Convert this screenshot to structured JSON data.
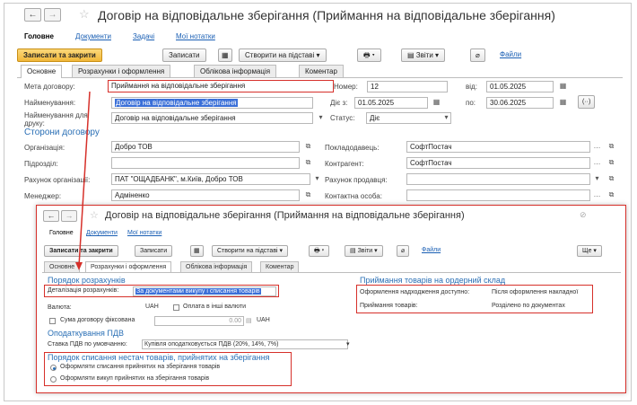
{
  "main_form": {
    "title": "Договір на відповідальне зберігання (Приймання на відповідальне зберігання)",
    "nav_tabs": [
      "Головне",
      "Документи",
      "Задачі",
      "Мої нотатки"
    ],
    "toolbar": {
      "save_close": "Записати та закрити",
      "save": "Записати",
      "create_based": "Створити на підставі",
      "reports": "Звіти",
      "files": "Файли"
    },
    "form_tabs": [
      "Основне",
      "Розрахунки і оформлення",
      "Облікова інформація",
      "Коментар"
    ],
    "fields": {
      "purpose_label": "Мета договору:",
      "purpose_value": "Приймання на відповідальне зберігання",
      "number_label": "Номер:",
      "number_value": "12",
      "from_label": "від:",
      "from_value": "01.05.2025",
      "name_label": "Найменування:",
      "name_value": "Договір на відповідальне зберігання",
      "valid_from_label": "Діє з:",
      "valid_from_value": "01.05.2025",
      "to_label": "по:",
      "to_value": "30.06.2025",
      "print_name_label": "Найменування для друку:",
      "print_name_value": "Договір на відповідальне зберігання",
      "status_label": "Статус:",
      "status_value": "Діє"
    },
    "parties": {
      "heading": "Сторони договору",
      "org_label": "Організація:",
      "org_value": "Добро ТОВ",
      "supplier_label": "Покладодавець:",
      "supplier_value": "СофтПостач",
      "division_label": "Підрозділ:",
      "division_value": "",
      "counterparty_label": "Контрагент:",
      "counterparty_value": "СофтПостач",
      "org_account_label": "Рахунок організації:",
      "org_account_value": "ПАТ \"ОЩАДБАНК\", м.Київ, Добро ТОВ",
      "seller_account_label": "Рахунок продавця:",
      "seller_account_value": "",
      "manager_label": "Менеджер:",
      "manager_value": "Адміненко",
      "contact_label": "Контактна особа:",
      "contact_value": ""
    }
  },
  "sub_form": {
    "title": "Договір на відповідальне зберігання (Приймання на відповідальне зберігання)",
    "nav_tabs": [
      "Головне",
      "Документи",
      "Мої нотатки"
    ],
    "toolbar": {
      "save_close": "Записати та закрити",
      "save": "Записати",
      "create_based": "Створити на підставі",
      "reports": "Звіти",
      "files": "Файли",
      "more": "Ще"
    },
    "form_tabs": [
      "Основне",
      "Розрахунки і оформлення",
      "Облікова інформація",
      "Коментар"
    ],
    "settlement": {
      "heading": "Порядок розрахунків",
      "detail_label": "Деталізація розрахунків:",
      "detail_value": "За документами викупу і списання товарів",
      "currency_label": "Валюта:",
      "currency_value": "UAH",
      "other_currency_label": "Оплата в інші валюти",
      "fixed_sum_label": "Сума договору фіксована",
      "sum_value": "0.00",
      "sum_currency": "UAH"
    },
    "taxation": {
      "heading": "Оподаткування ПДВ",
      "vat_label": "Ставка ПДВ по умовчанню:",
      "vat_value": "Купівля оподатковується ПДВ (20%, 14%, 7%)"
    },
    "writeoff": {
      "heading": "Порядок списання нестач товарів, прийнятих на зберігання",
      "option1": "Оформляти списання прийнятих на зберігання товарів",
      "option2": "Оформляти викуп прийнятих на зберігання товарів"
    },
    "receipt": {
      "heading": "Приймання товарів на ордерний склад",
      "available_label": "Оформлення надходження доступно:",
      "available_value": "Після оформлення накладної",
      "receipt_label": "Приймання товарів:",
      "receipt_value": "Розділено по документах"
    }
  },
  "icons": {
    "back": "←",
    "forward": "→",
    "star": "☆",
    "link": "⊘",
    "calendar": "▦",
    "dropdown": "▾",
    "ellipsis": "…",
    "open": "⧉"
  },
  "colors": {
    "accent": "#2a6fb5",
    "primary_button": "#f1b73a",
    "highlight_box": "#d6302a",
    "selection": "#3a6fd8"
  }
}
